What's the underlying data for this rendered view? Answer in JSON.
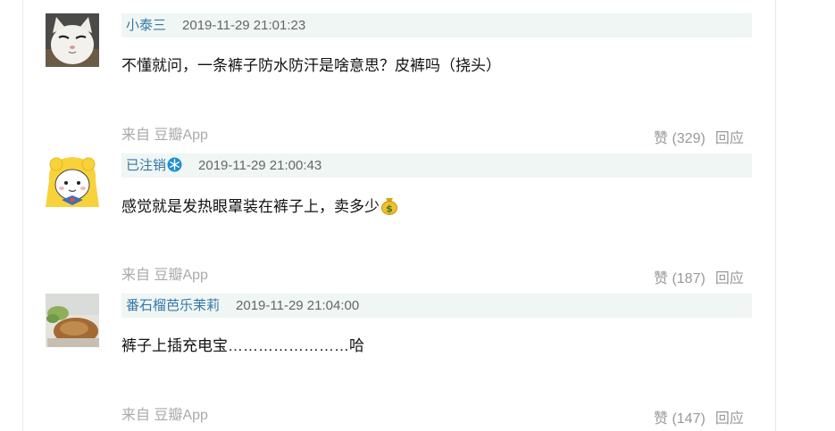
{
  "comments": [
    {
      "author": "小泰三",
      "time": "2019-11-29 21:01:23",
      "content": "不懂就问，一条裤子防水防汗是啥意思？皮裤吗（挠头）",
      "source": "来自 豆瓣App",
      "like_label": "赞 (329)",
      "reply_label": "回应"
    },
    {
      "author": "已注销",
      "author_icon": "snowflake-icon",
      "time": "2019-11-29 21:00:43",
      "content": "感觉就是发热眼罩装在裤子上，卖多少",
      "content_icon": "money-bag-icon",
      "source": "来自 豆瓣App",
      "like_label": "赞 (187)",
      "reply_label": "回应"
    },
    {
      "author": "番石榴芭乐茉莉",
      "time": "2019-11-29 21:04:00",
      "content": "裤子上插充电宝……………………哈",
      "source": "来自 豆瓣App",
      "like_label": "赞 (147)",
      "reply_label": "回应"
    }
  ],
  "colors": {
    "author_link": "#3377aa",
    "meta_bg": "#f0f6f3",
    "muted": "#aaaaaa"
  }
}
